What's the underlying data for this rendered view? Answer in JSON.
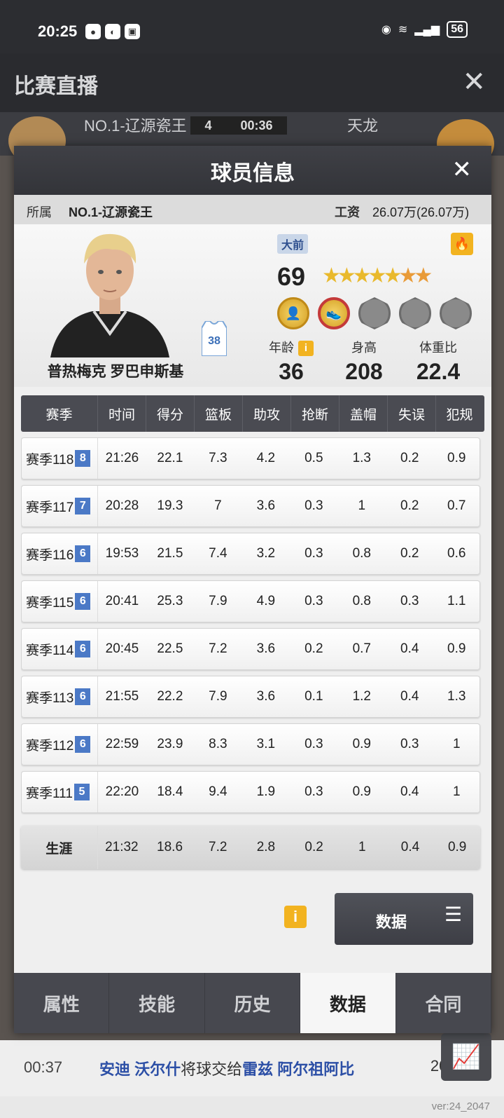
{
  "status": {
    "time": "20:25",
    "icons": [
      "chat-icon",
      "qq-icon",
      "game-icon"
    ],
    "right_icons": [
      "eye-icon",
      "wifi-icon",
      "5g-signal-icon"
    ],
    "battery": "56"
  },
  "live": {
    "title": "比赛直播",
    "team_left": "NO.1-辽源瓷王",
    "team_right": "天龙",
    "quarter": "4",
    "clock": "00:36"
  },
  "modal": {
    "title": "球员信息",
    "team_label": "所属",
    "team_value": "NO.1-辽源瓷王",
    "salary_label": "工资",
    "salary_value": "26.07万(26.07万)"
  },
  "player": {
    "name": "普热梅克 罗巴申斯基",
    "jersey": "38",
    "position": "大前",
    "rating": "69",
    "stars_full": 5,
    "stars_half": 2,
    "age_label": "年龄",
    "age": "36",
    "height_label": "身高",
    "height": "208",
    "weight_label": "体重比",
    "weight": "22.4"
  },
  "table": {
    "headers": [
      "赛季",
      "时间",
      "得分",
      "篮板",
      "助攻",
      "抢断",
      "盖帽",
      "失误",
      "犯规"
    ],
    "rows": [
      {
        "season": "赛季118",
        "lvl": "8",
        "time": "21:26",
        "pts": "22.1",
        "reb": "7.3",
        "ast": "4.2",
        "stl": "0.5",
        "blk": "1.3",
        "tov": "0.2",
        "pf": "0.9"
      },
      {
        "season": "赛季117",
        "lvl": "7",
        "time": "20:28",
        "pts": "19.3",
        "reb": "7",
        "ast": "3.6",
        "stl": "0.3",
        "blk": "1",
        "tov": "0.2",
        "pf": "0.7"
      },
      {
        "season": "赛季116",
        "lvl": "6",
        "time": "19:53",
        "pts": "21.5",
        "reb": "7.4",
        "ast": "3.2",
        "stl": "0.3",
        "blk": "0.8",
        "tov": "0.2",
        "pf": "0.6"
      },
      {
        "season": "赛季115",
        "lvl": "6",
        "time": "20:41",
        "pts": "25.3",
        "reb": "7.9",
        "ast": "4.9",
        "stl": "0.3",
        "blk": "0.8",
        "tov": "0.3",
        "pf": "1.1"
      },
      {
        "season": "赛季114",
        "lvl": "6",
        "time": "20:45",
        "pts": "22.5",
        "reb": "7.2",
        "ast": "3.6",
        "stl": "0.2",
        "blk": "0.7",
        "tov": "0.4",
        "pf": "0.9"
      },
      {
        "season": "赛季113",
        "lvl": "6",
        "time": "21:55",
        "pts": "22.2",
        "reb": "7.9",
        "ast": "3.6",
        "stl": "0.1",
        "blk": "1.2",
        "tov": "0.4",
        "pf": "1.3"
      },
      {
        "season": "赛季112",
        "lvl": "6",
        "time": "22:59",
        "pts": "23.9",
        "reb": "8.3",
        "ast": "3.1",
        "stl": "0.3",
        "blk": "0.9",
        "tov": "0.3",
        "pf": "1"
      },
      {
        "season": "赛季111",
        "lvl": "5",
        "time": "22:20",
        "pts": "18.4",
        "reb": "9.4",
        "ast": "1.9",
        "stl": "0.3",
        "blk": "0.9",
        "tov": "0.4",
        "pf": "1"
      }
    ],
    "career": {
      "season": "生涯",
      "time": "21:32",
      "pts": "18.6",
      "reb": "7.2",
      "ast": "2.8",
      "stl": "0.2",
      "blk": "1",
      "tov": "0.4",
      "pf": "0.9"
    }
  },
  "actions": {
    "data_button": "数据"
  },
  "tabs": [
    "属性",
    "技能",
    "历史",
    "数据",
    "合同"
  ],
  "active_tab": "数据",
  "playbyplay": {
    "time": "00:37",
    "player1": "安迪 沃尔什",
    "verb": "将球交给",
    "player2": "雷兹 阿尔祖阿比",
    "score": "206-115"
  },
  "version": "ver:24_2047"
}
